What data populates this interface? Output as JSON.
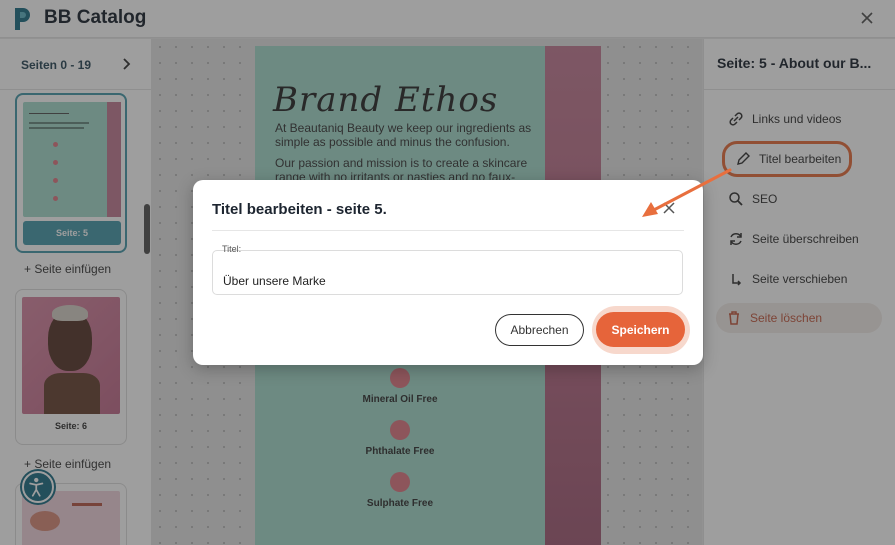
{
  "app": {
    "title": "BB Catalog"
  },
  "sidebar": {
    "pages_range": "Seiten 0 - 19",
    "pages": [
      {
        "label": "Seite: 5",
        "selected": true
      },
      {
        "label": "Seite: 6",
        "selected": false
      }
    ],
    "insert_label": "+ Seite einfügen"
  },
  "canvas_page": {
    "heading": "Brand Ethos",
    "paragraph1": "At Beautaniq Beauty we keep our ingredients as simple as possible and minus the confusion.",
    "paragraph2": "Our passion and mission is to create a skincare range with no irritants or nasties and no faux-",
    "features": [
      "Mineral Oil Free",
      "Phthalate Free",
      "Sulphate Free"
    ]
  },
  "right_panel": {
    "title": "Seite: 5 - About our B...",
    "items": [
      {
        "label": "Links und videos",
        "icon": "link-icon"
      },
      {
        "label": "Titel bearbeiten",
        "icon": "pencil-icon"
      },
      {
        "label": "SEO",
        "icon": "magnifier-icon"
      },
      {
        "label": "Seite überschreiben",
        "icon": "refresh-icon"
      },
      {
        "label": "Seite verschieben",
        "icon": "move-icon"
      },
      {
        "label": "Seite löschen",
        "icon": "trash-icon"
      }
    ]
  },
  "modal": {
    "title": "Titel bearbeiten - seite 5.",
    "field_label": "Titel:",
    "field_value": "Über unsere Marke",
    "cancel_label": "Abbrechen",
    "save_label": "Speichern"
  },
  "colors": {
    "accent": "#e6643a",
    "teal": "#4a9bab",
    "page_bg": "#a6dacd"
  }
}
